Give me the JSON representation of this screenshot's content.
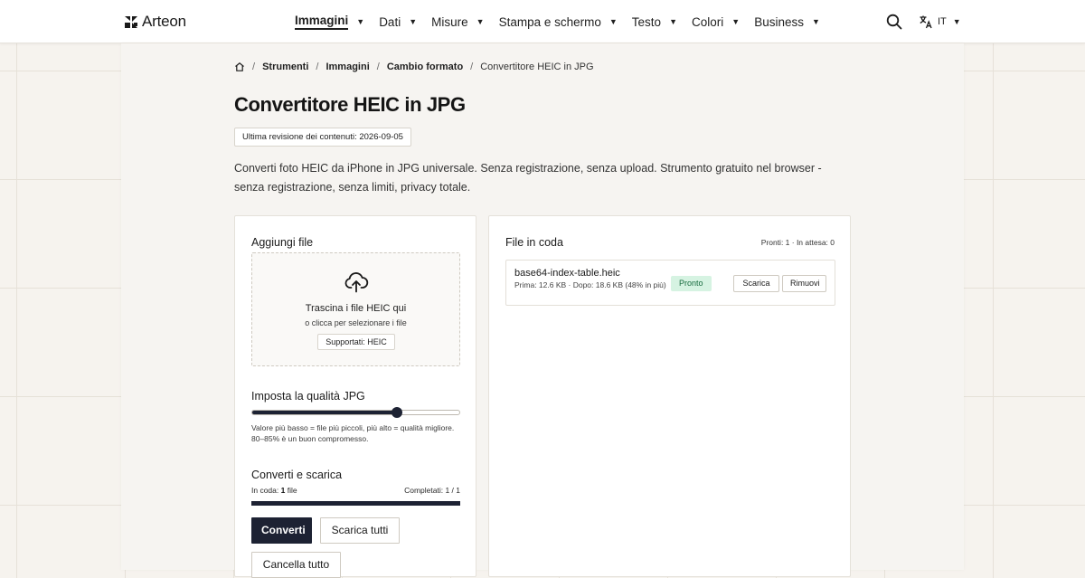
{
  "brand": {
    "name": "Arteon",
    "logo_icon": "arteon-logo-icon"
  },
  "nav": {
    "items": [
      {
        "label": "Immagini",
        "active": true
      },
      {
        "label": "Dati",
        "active": false
      },
      {
        "label": "Misure",
        "active": false
      },
      {
        "label": "Stampa e schermo",
        "active": false
      },
      {
        "label": "Testo",
        "active": false
      },
      {
        "label": "Colori",
        "active": false
      },
      {
        "label": "Business",
        "active": false
      }
    ],
    "caret": "▼",
    "search_icon": "search-icon",
    "language": {
      "code": "IT",
      "icon": "translate-icon"
    }
  },
  "breadcrumb": {
    "home_icon": "home-icon",
    "separator": "/",
    "links": [
      "Strumenti",
      "Immagini",
      "Cambio formato"
    ],
    "current": "Convertitore HEIC in JPG"
  },
  "page": {
    "title": "Convertitore HEIC in JPG",
    "revision": "Ultima revisione dei contenuti: 2026-09-05",
    "description": "Converti foto HEIC da iPhone in JPG universale. Senza registrazione, senza upload. Strumento gratuito nel browser - senza registrazione, senza limiti, privacy totale."
  },
  "add_files": {
    "title": "Aggiungi file",
    "upload_icon": "cloud-upload-icon",
    "drop_title": "Trascina i file HEIC qui",
    "drop_subtitle": "o clicca per selezionare i file",
    "supported": "Supportati: HEIC"
  },
  "quality": {
    "title": "Imposta la qualità JPG",
    "value_fraction": 0.7,
    "help": "Valore più basso = file più piccoli, più alto = qualità migliore. 80–85% è un buon compromesso."
  },
  "convert": {
    "title": "Converti e scarica",
    "queue_prefix": "In coda:",
    "queue_count": "1",
    "queue_suffix": "file",
    "completed": "Completati: 1 / 1",
    "progress_fraction": 1.0,
    "convert_label": "Converti",
    "download_all_label": "Scarica tutti",
    "clear_label": "Cancella tutto"
  },
  "queue": {
    "title": "File in coda",
    "summary": "Pronti: 1 · In attesa: 0",
    "files": [
      {
        "name": "base64-index-table.heic",
        "meta": "Prima: 12.6 KB · Dopo: 18.6 KB (48% in più)",
        "status": "Pronto",
        "download_label": "Scarica",
        "remove_label": "Rimuovi"
      }
    ]
  },
  "colors": {
    "accent": "#1d2233",
    "success_bg": "#d6f3e2",
    "success_text": "#176b3e",
    "page_bg": "#f6f3ee"
  }
}
